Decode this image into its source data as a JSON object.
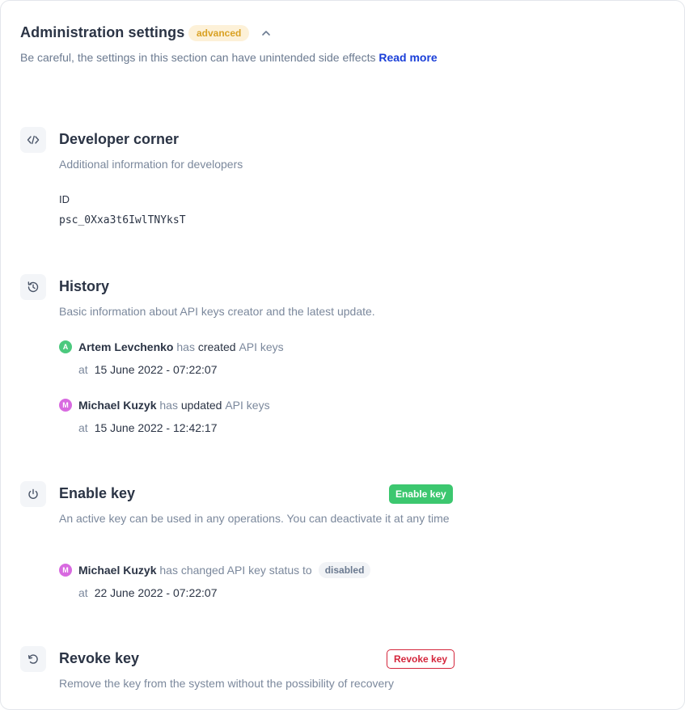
{
  "header": {
    "title": "Administration settings",
    "badge": "advanced",
    "description": "Be careful, the settings in this section can have unintended side effects",
    "read_more": "Read more"
  },
  "developer": {
    "title": "Developer corner",
    "description": "Additional information for developers",
    "id_label": "ID",
    "id_value": "psc_0Xxa3t6IwlTNYksT"
  },
  "history": {
    "title": "History",
    "description": "Basic information about API keys creator and the latest update.",
    "events": [
      {
        "initial": "A",
        "avatar_color": "#4cc97e",
        "user": "Artem Levchenko",
        "verb_pre": "has",
        "action": "created",
        "object": "API keys",
        "at": "at",
        "date": "15 June 2022 - 07:22:07"
      },
      {
        "initial": "M",
        "avatar_color": "#d86ae0",
        "user": "Michael Kuzyk",
        "verb_pre": "has",
        "action": "updated",
        "object": "API keys",
        "at": "at",
        "date": "15 June 2022 - 12:42:17"
      }
    ]
  },
  "enable": {
    "title": "Enable key",
    "button": "Enable key",
    "description": "An active key can be used in any operations. You can deactivate it at any time",
    "event": {
      "initial": "M",
      "avatar_color": "#d86ae0",
      "user": "Michael Kuzyk",
      "text": "has changed API key status to",
      "status": "disabled",
      "at": "at",
      "date": "22 June 2022 - 07:22:07"
    }
  },
  "revoke": {
    "title": "Revoke key",
    "button": "Revoke key",
    "description": "Remove the key from the system without the possibility of recovery"
  },
  "icons": {
    "collapse": "chevron-up-icon",
    "developer": "code-icon",
    "history": "history-icon",
    "enable": "power-icon",
    "revoke": "revoke-icon"
  },
  "colors": {
    "accent_link": "#1a3fd8",
    "badge_bg": "#fdf1d8",
    "badge_text": "#d9a123",
    "enable_button": "#3cc76f",
    "revoke_button": "#d4253b"
  }
}
